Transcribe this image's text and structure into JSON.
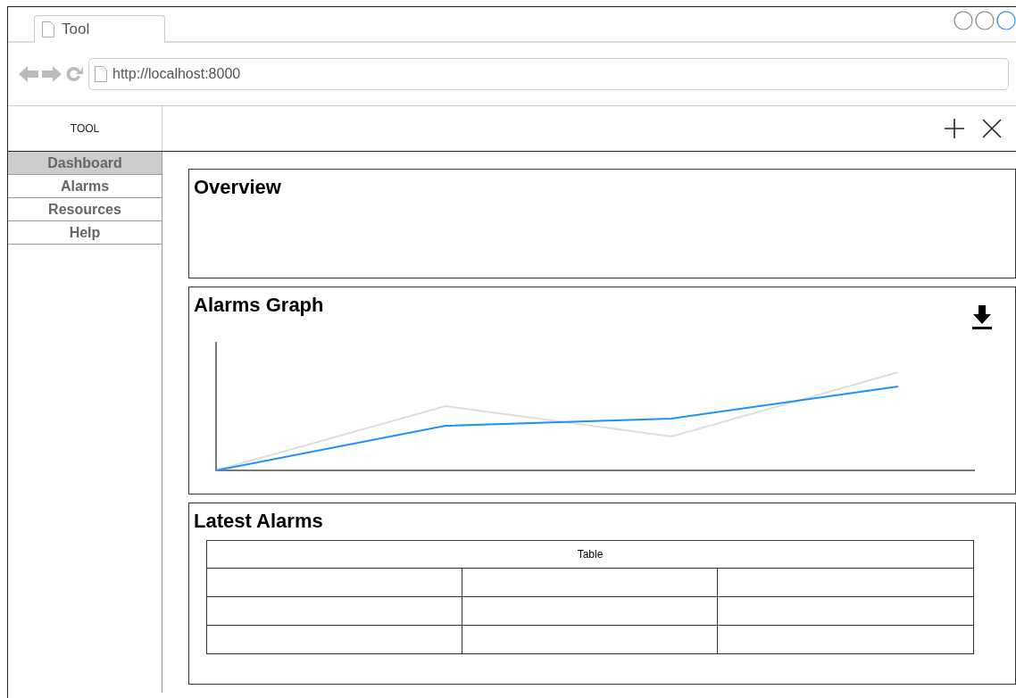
{
  "browser": {
    "tab_title": "Tool",
    "url": "http://localhost:8000"
  },
  "app": {
    "logo": "TOOL"
  },
  "sidebar": {
    "items": [
      {
        "label": "Dashboard",
        "selected": true
      },
      {
        "label": "Alarms",
        "selected": false
      },
      {
        "label": "Resources",
        "selected": false
      },
      {
        "label": "Help",
        "selected": false
      }
    ]
  },
  "panels": [
    {
      "kind": "empty",
      "title": "Overview"
    },
    {
      "kind": "graph",
      "title": "Alarms Graph"
    },
    {
      "kind": "table",
      "title": "Latest Alarms",
      "table": {
        "caption": "Table"
      }
    }
  ]
}
